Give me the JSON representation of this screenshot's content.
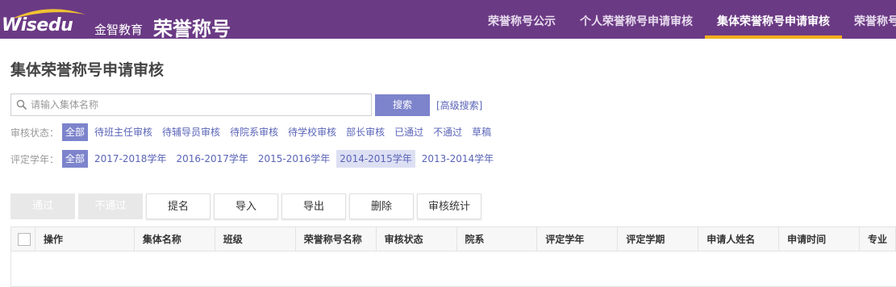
{
  "header": {
    "logo_text": "Wisedu",
    "logo_cn": "金智教育",
    "app_title": "荣誉称号",
    "nav": [
      {
        "label": "荣誉称号公示"
      },
      {
        "label": "个人荣誉称号申请审核"
      },
      {
        "label": "集体荣誉称号申请审核"
      },
      {
        "label": "荣誉称号"
      }
    ],
    "active_nav": "集体荣誉称号申请审核",
    "accent_color": "#f0ad1c",
    "bar_color": "#6b3a84"
  },
  "page_title": "集体荣誉称号申请审核",
  "search": {
    "placeholder": "请输入集体名称",
    "value": "",
    "button_label": "搜索",
    "advanced_link": "[高级搜索]"
  },
  "filters": {
    "status": {
      "label": "审核状态：",
      "options": [
        "全部",
        "待班主任审核",
        "待辅导员审核",
        "待院系审核",
        "待学校审核",
        "部长审核",
        "已通过",
        "不通过",
        "草稿"
      ],
      "selected": "全部"
    },
    "year": {
      "label": "评定学年：",
      "options": [
        "全部",
        "2017-2018学年",
        "2016-2017学年",
        "2015-2016学年",
        "2014-2015学年",
        "2013-2014学年"
      ],
      "selected": "全部",
      "hovered": "2014-2015学年"
    }
  },
  "toolbar": {
    "pass_label": "通过",
    "reject_label": "不通过",
    "nominate_label": "提名",
    "import_label": "导入",
    "export_label": "导出",
    "delete_label": "删除",
    "stats_label": "审核统计"
  },
  "table": {
    "columns": [
      "操作",
      "集体名称",
      "班级",
      "荣誉称号名称",
      "审核状态",
      "院系",
      "评定学年",
      "评定学期",
      "申请人姓名",
      "申请时间",
      "专业"
    ],
    "rows": []
  }
}
